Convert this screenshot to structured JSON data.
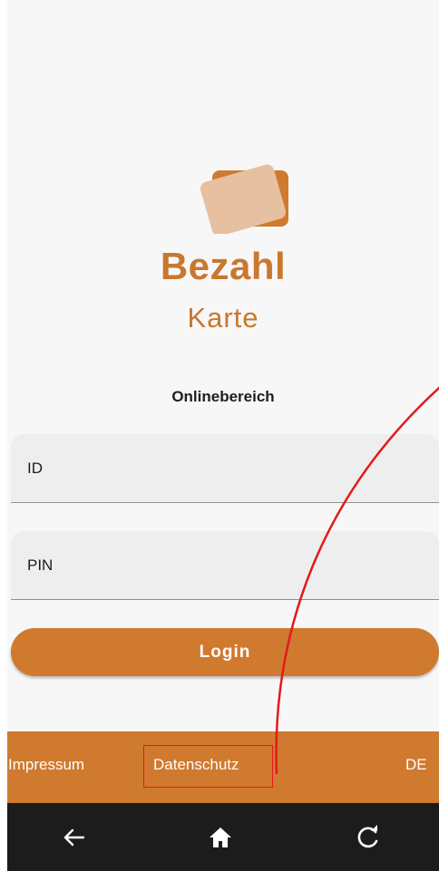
{
  "brand": {
    "line1": "Bezahl",
    "line2": "Karte",
    "logo_icon": "card-stack-icon",
    "primary_color": "#d07a2f",
    "secondary_color": "#e6c0a0"
  },
  "login": {
    "section_title": "Onlinebereich",
    "id_label": "ID",
    "pin_label": "PIN",
    "login_button": "Login"
  },
  "footer": {
    "impressum": "Impressum",
    "datenschutz": "Datenschutz",
    "language": "DE"
  },
  "navbar": {
    "back_icon": "back-arrow-icon",
    "home_icon": "home-icon",
    "reload_icon": "reload-icon"
  },
  "annotation": {
    "color": "#e11b1b"
  }
}
